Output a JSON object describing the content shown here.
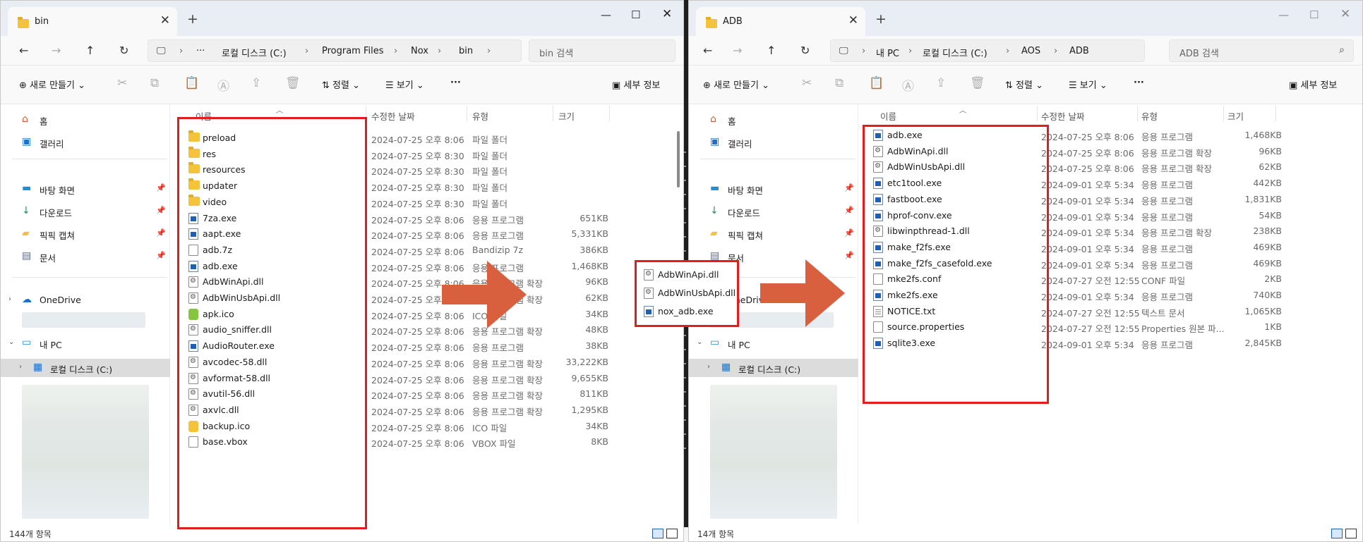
{
  "left_window": {
    "tab_title": "bin",
    "breadcrumb": [
      "로컬 디스크 (C:)",
      "Program Files",
      "Nox",
      "bin"
    ],
    "breadcrumb_more": "···",
    "search_placeholder": "bin 검색",
    "toolbar": {
      "new": "새로 만들기",
      "sort": "정렬",
      "view": "보기",
      "more": "···",
      "details": "세부 정보"
    },
    "columns": {
      "name": "이름",
      "modified": "수정한 날짜",
      "type": "유형",
      "size": "크기"
    },
    "sidebar": {
      "home": "홈",
      "gallery": "갤러리",
      "desktop": "바탕 화면",
      "downloads": "다운로드",
      "pickpick": "픽픽 캡쳐",
      "documents": "문서",
      "onedrive": "OneDrive",
      "mypc": "내 PC",
      "localdisk": "로컬 디스크 (C:)"
    },
    "rows": [
      {
        "name": "preload",
        "date": "2024-07-25 오후 8:06",
        "type": "파일 폴더",
        "size": "",
        "icon": "folder"
      },
      {
        "name": "res",
        "date": "2024-07-25 오후 8:30",
        "type": "파일 폴더",
        "size": "",
        "icon": "folder"
      },
      {
        "name": "resources",
        "date": "2024-07-25 오후 8:30",
        "type": "파일 폴더",
        "size": "",
        "icon": "folder"
      },
      {
        "name": "updater",
        "date": "2024-07-25 오후 8:30",
        "type": "파일 폴더",
        "size": "",
        "icon": "folder"
      },
      {
        "name": "video",
        "date": "2024-07-25 오후 8:30",
        "type": "파일 폴더",
        "size": "",
        "icon": "folder"
      },
      {
        "name": "7za.exe",
        "date": "2024-07-25 오후 8:06",
        "type": "응용 프로그램",
        "size": "651KB",
        "icon": "exe"
      },
      {
        "name": "aapt.exe",
        "date": "2024-07-25 오후 8:06",
        "type": "응용 프로그램",
        "size": "5,331KB",
        "icon": "exe"
      },
      {
        "name": "adb.7z",
        "date": "2024-07-25 오후 8:06",
        "type": "Bandizip 7z",
        "size": "386KB",
        "icon": "file"
      },
      {
        "name": "adb.exe",
        "date": "2024-07-25 오후 8:06",
        "type": "응용 프로그램",
        "size": "1,468KB",
        "icon": "exe"
      },
      {
        "name": "AdbWinApi.dll",
        "date": "2024-07-25 오후 8:06",
        "type": "응용 프로그램 확장",
        "size": "96KB",
        "icon": "dll"
      },
      {
        "name": "AdbWinUsbApi.dll",
        "date": "2024-07-25 오후 8:06",
        "type": "응용 프로그램 확장",
        "size": "62KB",
        "icon": "dll"
      },
      {
        "name": "apk.ico",
        "date": "2024-07-25 오후 8:06",
        "type": "ICO 파일",
        "size": "34KB",
        "icon": "apk"
      },
      {
        "name": "audio_sniffer.dll",
        "date": "2024-07-25 오후 8:06",
        "type": "응용 프로그램 확장",
        "size": "48KB",
        "icon": "dll"
      },
      {
        "name": "AudioRouter.exe",
        "date": "2024-07-25 오후 8:06",
        "type": "응용 프로그램",
        "size": "38KB",
        "icon": "exe"
      },
      {
        "name": "avcodec-58.dll",
        "date": "2024-07-25 오후 8:06",
        "type": "응용 프로그램 확장",
        "size": "33,222KB",
        "icon": "dll"
      },
      {
        "name": "avformat-58.dll",
        "date": "2024-07-25 오후 8:06",
        "type": "응용 프로그램 확장",
        "size": "9,655KB",
        "icon": "dll"
      },
      {
        "name": "avutil-56.dll",
        "date": "2024-07-25 오후 8:06",
        "type": "응용 프로그램 확장",
        "size": "811KB",
        "icon": "dll"
      },
      {
        "name": "axvlc.dll",
        "date": "2024-07-25 오후 8:06",
        "type": "응용 프로그램 확장",
        "size": "1,295KB",
        "icon": "dll"
      },
      {
        "name": "backup.ico",
        "date": "2024-07-25 오후 8:06",
        "type": "ICO 파일",
        "size": "34KB",
        "icon": "ico"
      },
      {
        "name": "base.vbox",
        "date": "2024-07-25 오후 8:06",
        "type": "VBOX 파일",
        "size": "8KB",
        "icon": "file"
      }
    ],
    "status": "144개 항목"
  },
  "popup": {
    "rows": [
      {
        "name": "AdbWinApi.dll",
        "icon": "dll"
      },
      {
        "name": "AdbWinUsbApi.dll",
        "icon": "dll"
      },
      {
        "name": "nox_adb.exe",
        "icon": "exe"
      }
    ]
  },
  "right_window": {
    "tab_title": "ADB",
    "breadcrumb": [
      "내 PC",
      "로컬 디스크 (C:)",
      "AOS",
      "ADB"
    ],
    "search_placeholder": "ADB 검색",
    "toolbar": {
      "new": "새로 만들기",
      "sort": "정렬",
      "view": "보기",
      "more": "···",
      "details": "세부 정보"
    },
    "columns": {
      "name": "이름",
      "modified": "수정한 날짜",
      "type": "유형",
      "size": "크기"
    },
    "sidebar": {
      "home": "홈",
      "gallery": "갤러리",
      "desktop": "바탕 화면",
      "downloads": "다운로드",
      "pickpick": "픽픽 캡쳐",
      "documents": "문서",
      "onedrive": "OneDrive",
      "mypc": "내 PC",
      "localdisk": "로컬 디스크 (C:)"
    },
    "rows": [
      {
        "name": "adb.exe",
        "date": "2024-07-25 오후 8:06",
        "type": "응용 프로그램",
        "size": "1,468KB",
        "icon": "exe"
      },
      {
        "name": "AdbWinApi.dll",
        "date": "2024-07-25 오후 8:06",
        "type": "응용 프로그램 확장",
        "size": "96KB",
        "icon": "dll"
      },
      {
        "name": "AdbWinUsbApi.dll",
        "date": "2024-07-25 오후 8:06",
        "type": "응용 프로그램 확장",
        "size": "62KB",
        "icon": "dll"
      },
      {
        "name": "etc1tool.exe",
        "date": "2024-09-01 오후 5:34",
        "type": "응용 프로그램",
        "size": "442KB",
        "icon": "exe"
      },
      {
        "name": "fastboot.exe",
        "date": "2024-09-01 오후 5:34",
        "type": "응용 프로그램",
        "size": "1,831KB",
        "icon": "exe"
      },
      {
        "name": "hprof-conv.exe",
        "date": "2024-09-01 오후 5:34",
        "type": "응용 프로그램",
        "size": "54KB",
        "icon": "exe"
      },
      {
        "name": "libwinpthread-1.dll",
        "date": "2024-09-01 오후 5:34",
        "type": "응용 프로그램 확장",
        "size": "238KB",
        "icon": "dll"
      },
      {
        "name": "make_f2fs.exe",
        "date": "2024-09-01 오후 5:34",
        "type": "응용 프로그램",
        "size": "469KB",
        "icon": "exe"
      },
      {
        "name": "make_f2fs_casefold.exe",
        "date": "2024-09-01 오후 5:34",
        "type": "응용 프로그램",
        "size": "469KB",
        "icon": "exe"
      },
      {
        "name": "mke2fs.conf",
        "date": "2024-07-27 오전 12:55",
        "type": "CONF 파일",
        "size": "2KB",
        "icon": "file"
      },
      {
        "name": "mke2fs.exe",
        "date": "2024-09-01 오후 5:34",
        "type": "응용 프로그램",
        "size": "740KB",
        "icon": "exe"
      },
      {
        "name": "NOTICE.txt",
        "date": "2024-07-27 오전 12:55",
        "type": "텍스트 문서",
        "size": "1,065KB",
        "icon": "txt"
      },
      {
        "name": "source.properties",
        "date": "2024-07-27 오전 12:55",
        "type": "Properties 원본 파...",
        "size": "1KB",
        "icon": "file"
      },
      {
        "name": "sqlite3.exe",
        "date": "2024-09-01 오후 5:34",
        "type": "응용 프로그램",
        "size": "2,845KB",
        "icon": "exe"
      }
    ],
    "status": "14개 항목"
  },
  "colors": {
    "highlight_red": "#e61b1b",
    "arrow": "#d9603f"
  }
}
